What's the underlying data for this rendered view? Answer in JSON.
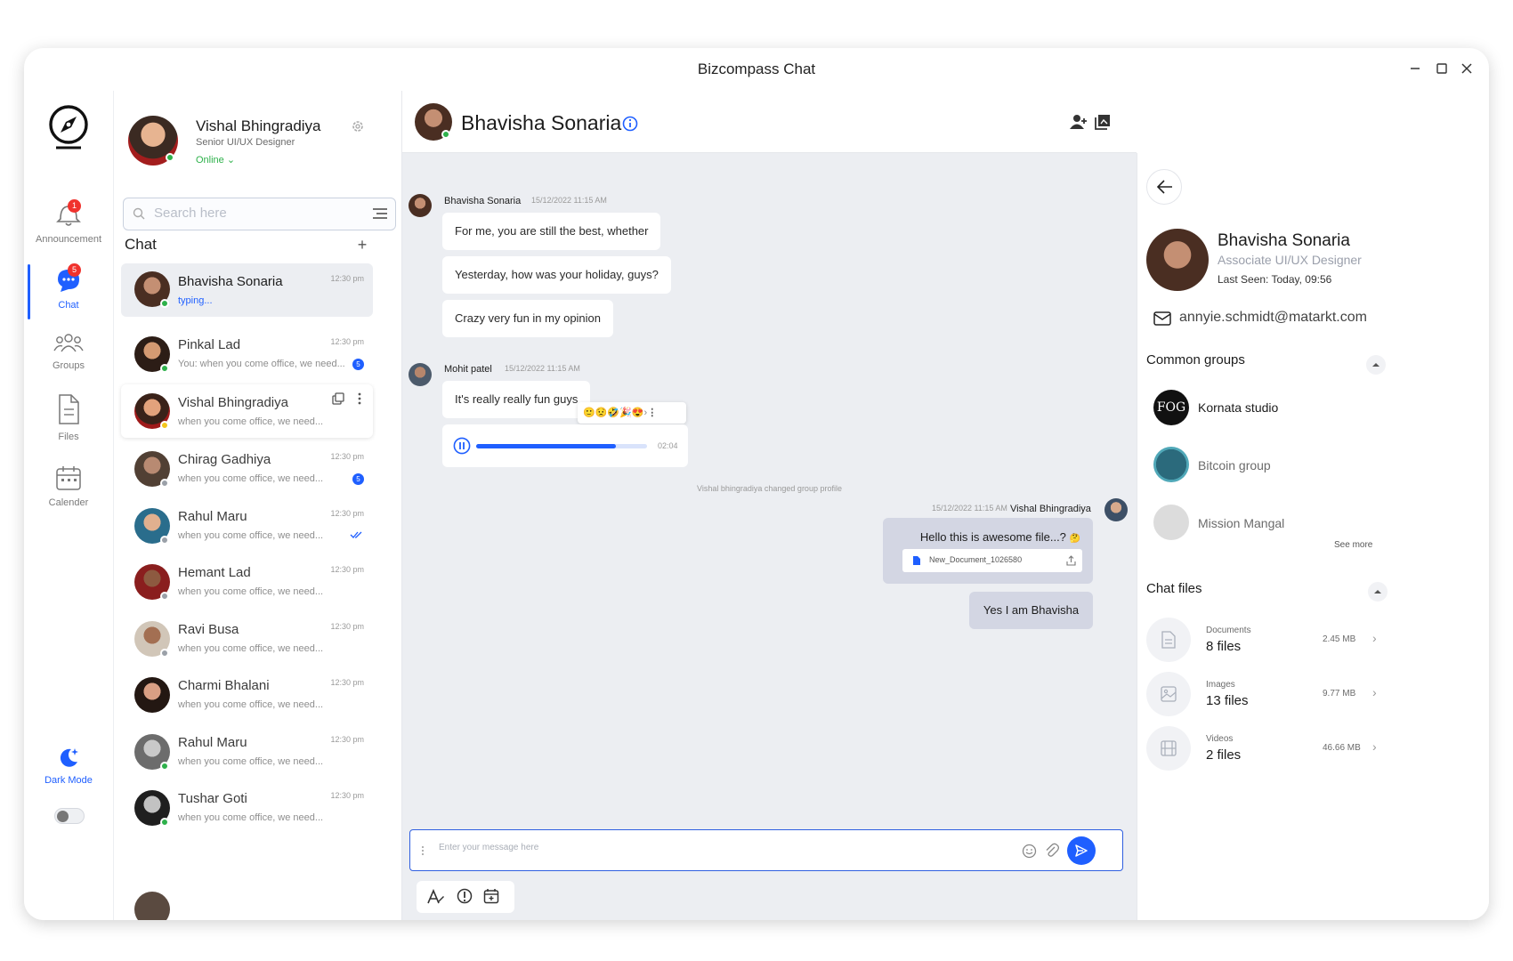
{
  "window": {
    "title": "Bizcompass Chat"
  },
  "rail": {
    "items": [
      {
        "label": "Announcement",
        "badge": "1"
      },
      {
        "label": "Chat",
        "badge": "5"
      },
      {
        "label": "Groups"
      },
      {
        "label": "Files"
      },
      {
        "label": "Calender"
      }
    ],
    "dark_mode_label": "Dark Mode"
  },
  "me": {
    "name": "Vishal Bhingradiya",
    "role": "Senior UI/UX Designer",
    "status": "Online"
  },
  "search": {
    "placeholder": "Search here"
  },
  "chat_list": {
    "heading": "Chat",
    "items": [
      {
        "name": "Bhavisha Sonaria",
        "preview": "typing...",
        "time": "12:30 pm"
      },
      {
        "name": "Pinkal Lad",
        "preview": "You: when you come office, we need...",
        "time": "12:30 pm",
        "count": "5"
      },
      {
        "name": "Vishal Bhingradiya",
        "preview": "when you come office, we need..."
      },
      {
        "name": "Chirag Gadhiya",
        "preview": "when you come office, we need...",
        "time": "12:30 pm",
        "count": "5"
      },
      {
        "name": "Rahul Maru",
        "preview": "when you come office, we need...",
        "time": "12:30 pm"
      },
      {
        "name": "Hemant Lad",
        "preview": "when you come office, we need...",
        "time": "12:30 pm"
      },
      {
        "name": "Ravi Busa",
        "preview": "when you come office, we need...",
        "time": "12:30 pm"
      },
      {
        "name": "Charmi Bhalani",
        "preview": "when you come office, we need...",
        "time": "12:30 pm"
      },
      {
        "name": "Rahul Maru",
        "preview": "when you come office, we need...",
        "time": "12:30 pm"
      },
      {
        "name": "Tushar Goti",
        "preview": "when you come office, we need...",
        "time": "12:30 pm"
      }
    ]
  },
  "conversation": {
    "contact_name": "Bhavisha Sonaria",
    "group1": {
      "sender": "Bhavisha Sonaria",
      "time": "15/12/2022 11:15 AM",
      "messages": [
        "For me, you are still the best, whether",
        "Yesterday, how was your holiday, guys?",
        "Crazy very fun in my opinion"
      ]
    },
    "group2": {
      "sender": "Mohit patel",
      "time": "15/12/2022 11:15 AM",
      "message": "It's really really fun guys",
      "audio_duration": "02:04",
      "audio_progress": 0.82
    },
    "system_note": "Vishal bhingradiya changed group profile",
    "outgoing": {
      "sender": "Vishal Bhingradiya",
      "time": "15/12/2022 11:15 AM",
      "message": "Hello this is awesome file...?",
      "file_name": "New_Document_1026580",
      "reply": "Yes I am Bhavisha"
    },
    "composer_placeholder": "Enter your message here"
  },
  "info": {
    "name": "Bhavisha Sonaria",
    "role": "Associate UI/UX Designer",
    "last_seen_label": "Last Seen:",
    "last_seen_value": "Today, 09:56",
    "email": "annyie.schmidt@matarkt.com",
    "common_groups_title": "Common groups",
    "groups": [
      "Kornata studio",
      "Bitcoin group",
      "Mission Mangal"
    ],
    "see_more": "See more",
    "chat_files_title": "Chat files",
    "files": [
      {
        "category": "Documents",
        "count": "8 files",
        "size": "2.45 MB"
      },
      {
        "category": "Images",
        "count": "13 files",
        "size": "9.77 MB"
      },
      {
        "category": "Videos",
        "count": "2 files",
        "size": "46.66 MB"
      }
    ],
    "avatar_text": "FOG"
  },
  "colors": {
    "accent": "#1f5fff",
    "online": "#2eb14b",
    "badge": "#f0322d",
    "chat_bg": "#eceef2",
    "outgoing_bubble": "#d3d6e3"
  }
}
